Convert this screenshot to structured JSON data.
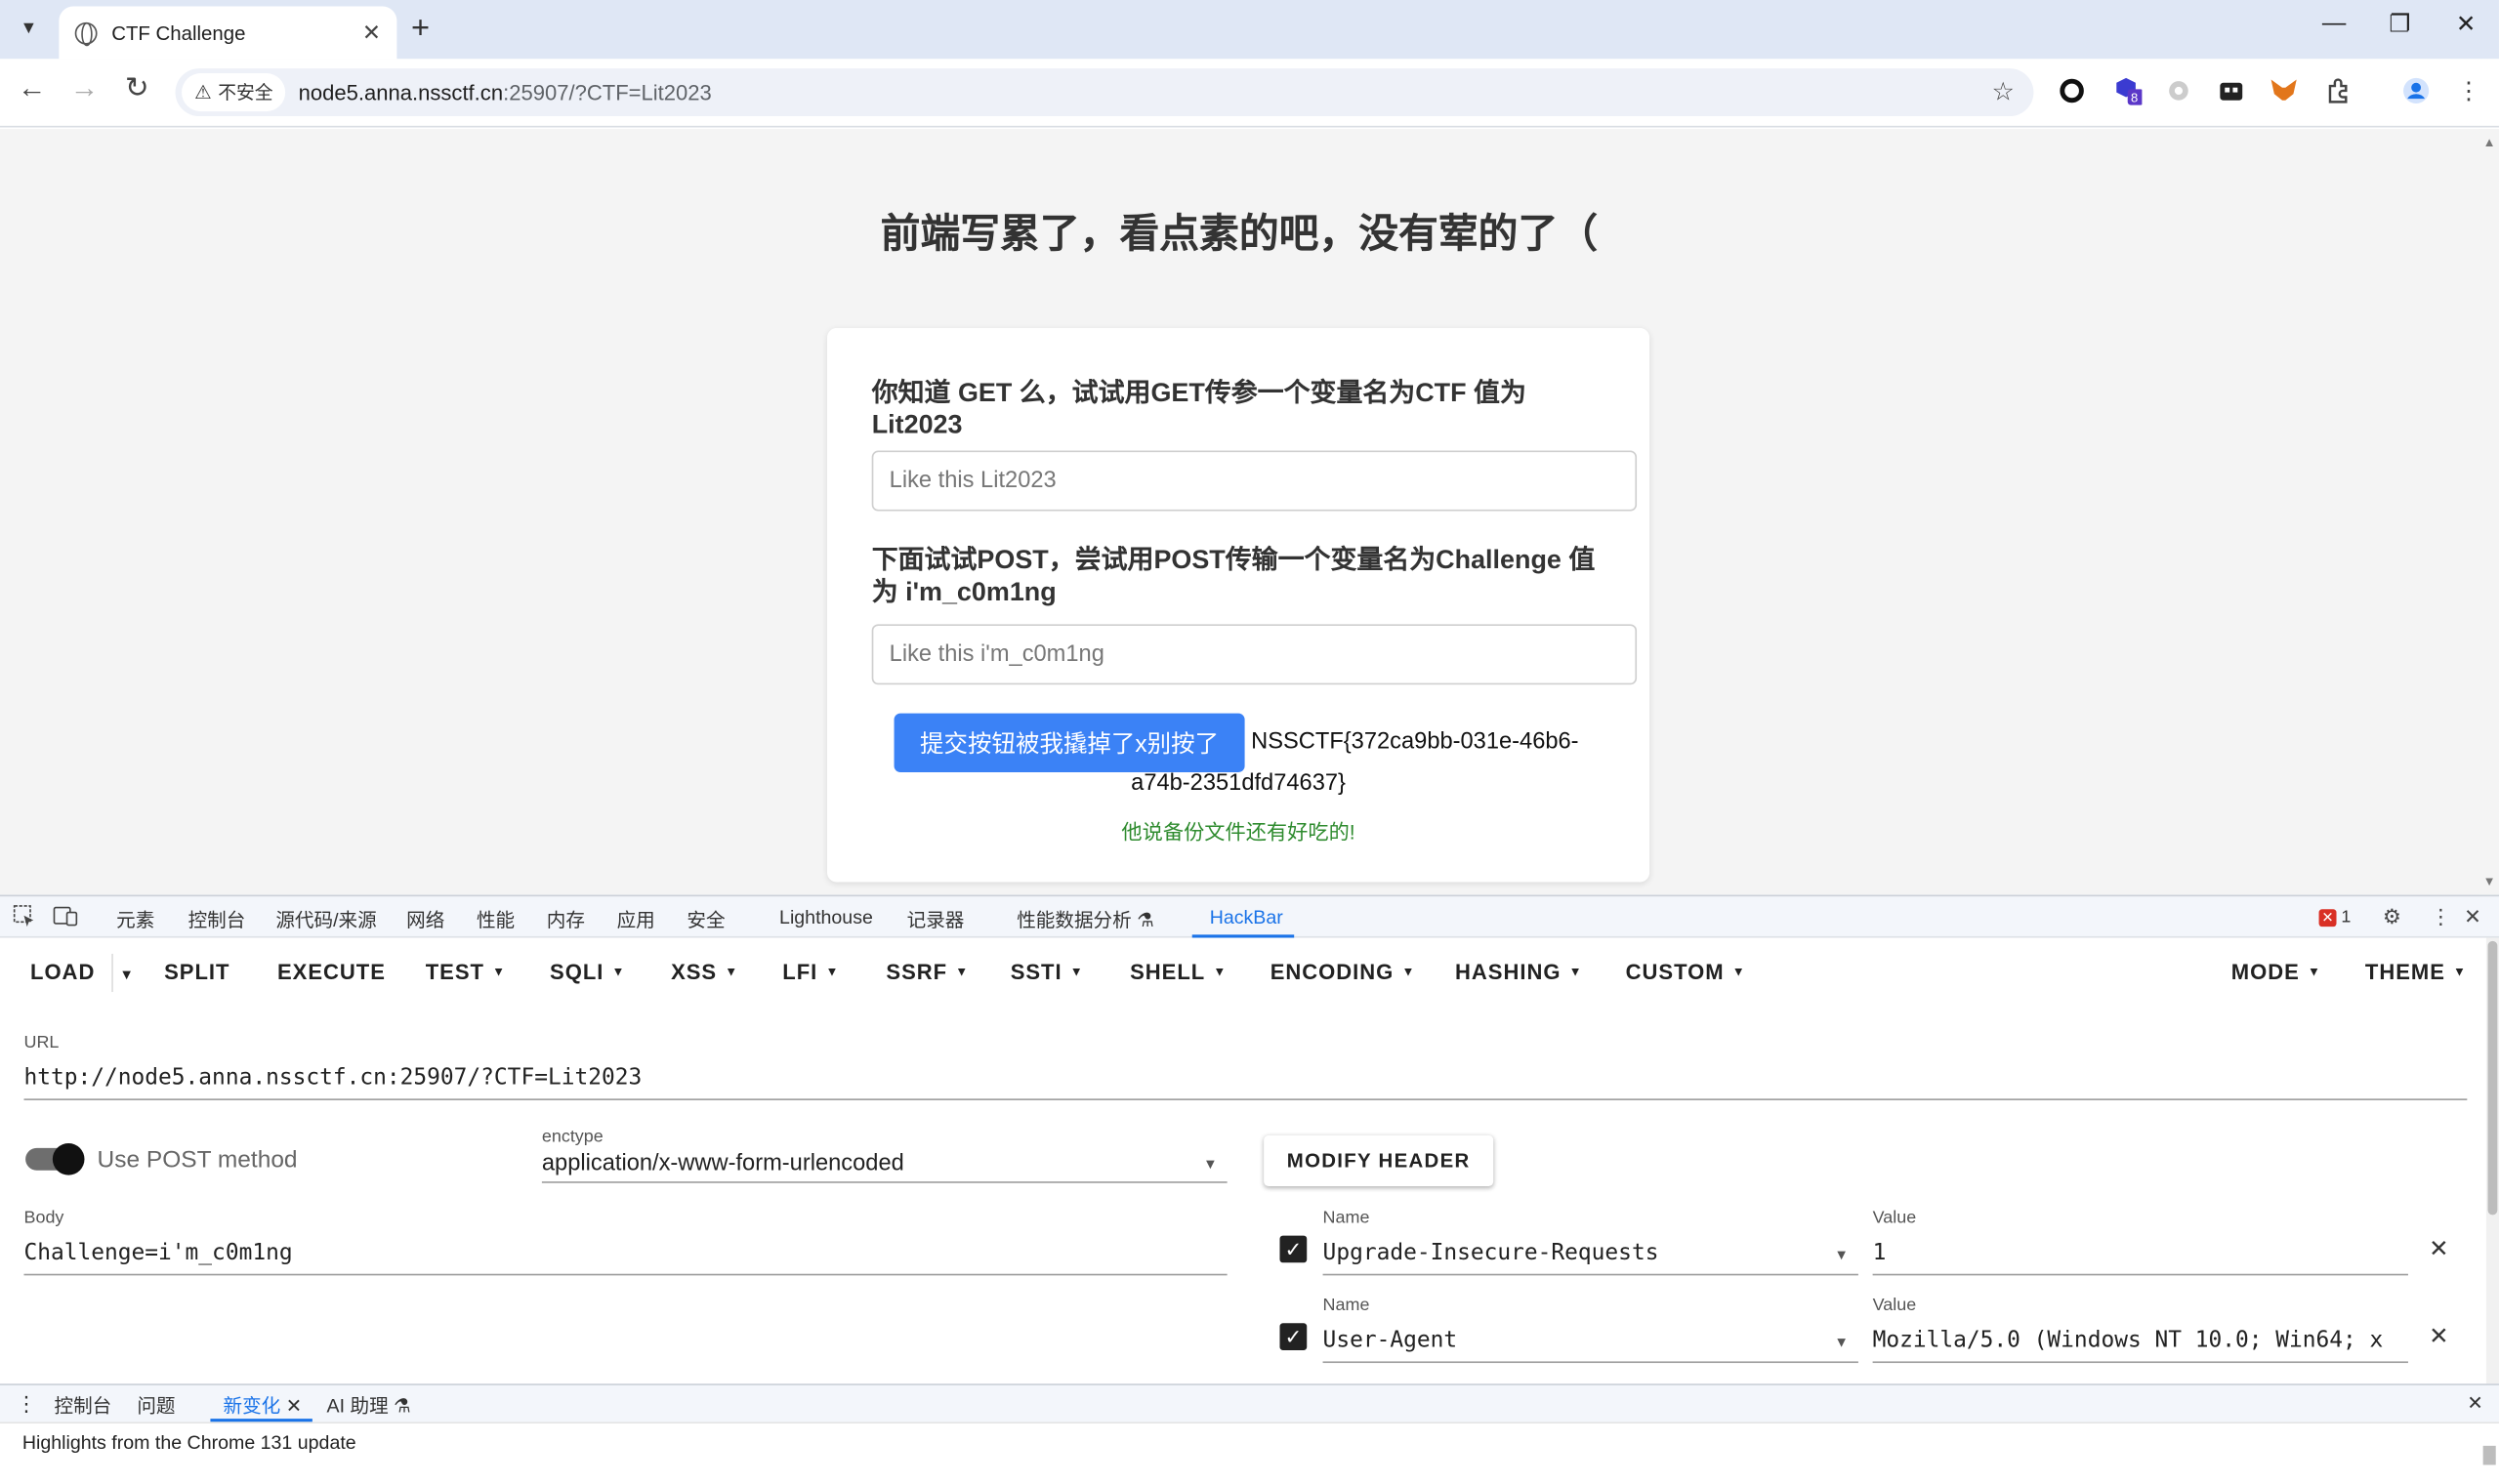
{
  "browser": {
    "tab_title": "CTF Challenge",
    "security_label": "不安全",
    "url_host": "node5.anna.nssctf.cn",
    "url_rest": ":25907/?CTF=Lit2023",
    "ext_badge": "8"
  },
  "page": {
    "title": "前端写累了，看点素的吧，没有荤的了（",
    "q1": "你知道 GET 么，试试用GET传参一个变量名为CTF 值为 Lit2023",
    "input1_placeholder": "Like this Lit2023",
    "q2": "下面试试POST，尝试用POST传输一个变量名为Challenge 值为 i'm_c0m1ng",
    "input2_placeholder": "Like this i'm_c0m1ng",
    "submit_label": "提交按钮被我撬掉了x别按了",
    "flag_line1": "NSSCTF{372ca9bb-031e-46b6-",
    "flag_line2": "a74b-2351dfd74637}",
    "hint": "他说备份文件还有好吃的!"
  },
  "devtools": {
    "tabs": [
      "元素",
      "控制台",
      "源代码/来源",
      "网络",
      "性能",
      "内存",
      "应用",
      "安全",
      "Lighthouse",
      "记录器",
      "性能数据分析",
      "HackBar"
    ],
    "error_count": "1"
  },
  "hackbar": {
    "menu": {
      "load": "LOAD",
      "split": "SPLIT",
      "execute": "EXECUTE",
      "test": "TEST",
      "sqli": "SQLI",
      "xss": "XSS",
      "lfi": "LFI",
      "ssrf": "SSRF",
      "ssti": "SSTI",
      "shell": "SHELL",
      "encoding": "ENCODING",
      "hashing": "HASHING",
      "custom": "CUSTOM",
      "mode": "MODE",
      "theme": "THEME"
    },
    "url_label": "URL",
    "url_value": "http://node5.anna.nssctf.cn:25907/?CTF=Lit2023",
    "post_toggle_label": "Use POST method",
    "post_enabled": true,
    "enctype_label": "enctype",
    "enctype_value": "application/x-www-form-urlencoded",
    "modify_header_label": "MODIFY HEADER",
    "body_label": "Body",
    "body_value": "Challenge=i'm_c0m1ng",
    "headers": [
      {
        "name_label": "Name",
        "name": "Upgrade-Insecure-Requests",
        "value_label": "Value",
        "value": "1",
        "enabled": true
      },
      {
        "name_label": "Name",
        "name": "User-Agent",
        "value_label": "Value",
        "value": "Mozilla/5.0 (Windows NT 10.0; Win64; x",
        "enabled": true
      }
    ]
  },
  "drawer": {
    "tabs": [
      "控制台",
      "问题",
      "新变化",
      "AI 助理"
    ],
    "message": "Highlights from the Chrome 131 update"
  }
}
